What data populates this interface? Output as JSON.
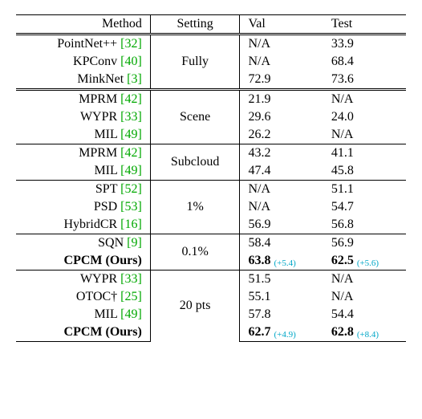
{
  "headers": {
    "method": "Method",
    "setting": "Setting",
    "val": "Val",
    "test": "Test"
  },
  "groups": [
    {
      "setting": "Fully",
      "top_rule": "double",
      "rows": [
        {
          "method": "PointNet++",
          "ref": "[32]",
          "val": "N/A",
          "test": "33.9"
        },
        {
          "method": "KPConv",
          "ref": "[40]",
          "val": "N/A",
          "test": "68.4"
        },
        {
          "method": "MinkNet",
          "ref": "[3]",
          "val": "72.9",
          "test": "73.6"
        }
      ]
    },
    {
      "setting": "Scene",
      "top_rule": "double",
      "rows": [
        {
          "method": "MPRM",
          "ref": "[42]",
          "val": "21.9",
          "test": "N/A"
        },
        {
          "method": "WYPR",
          "ref": "[33]",
          "val": "29.6",
          "test": "24.0"
        },
        {
          "method": "MIL",
          "ref": "[49]",
          "val": "26.2",
          "test": "N/A"
        }
      ]
    },
    {
      "setting": "Subcloud",
      "top_rule": "thin",
      "rows": [
        {
          "method": "MPRM",
          "ref": "[42]",
          "val": "43.2",
          "test": "41.1"
        },
        {
          "method": "MIL",
          "ref": "[49]",
          "val": "47.4",
          "test": "45.8"
        }
      ]
    },
    {
      "setting": "1%",
      "top_rule": "thin",
      "rows": [
        {
          "method": "SPT",
          "ref": "[52]",
          "val": "N/A",
          "test": "51.1"
        },
        {
          "method": "PSD",
          "ref": "[53]",
          "val": "N/A",
          "test": "54.7"
        },
        {
          "method": "HybridCR",
          "ref": "[16]",
          "val": "56.9",
          "test": "56.8"
        }
      ]
    },
    {
      "setting": "0.1%",
      "top_rule": "thin",
      "rows": [
        {
          "method": "SQN",
          "ref": "[9]",
          "val": "58.4",
          "test": "56.9"
        },
        {
          "method": "CPCM (Ours)",
          "ref": "",
          "val": "63.8",
          "val_delta": "(+5.4)",
          "test": "62.5",
          "test_delta": "(+5.6)",
          "bold": true
        }
      ]
    },
    {
      "setting": "20 pts",
      "top_rule": "thin",
      "bottom_rule": true,
      "rows": [
        {
          "method": "WYPR",
          "ref": "[33]",
          "val": "51.5",
          "test": "N/A"
        },
        {
          "method": "OTOC†",
          "ref": "[25]",
          "val": "55.1",
          "test": "N/A"
        },
        {
          "method": "MIL",
          "ref": "[49]",
          "val": "57.8",
          "test": "54.4"
        },
        {
          "method": "CPCM (Ours)",
          "ref": "",
          "val": "62.7",
          "val_delta": "(+4.9)",
          "test": "62.8",
          "test_delta": "(+8.4)",
          "bold": true
        }
      ]
    }
  ]
}
